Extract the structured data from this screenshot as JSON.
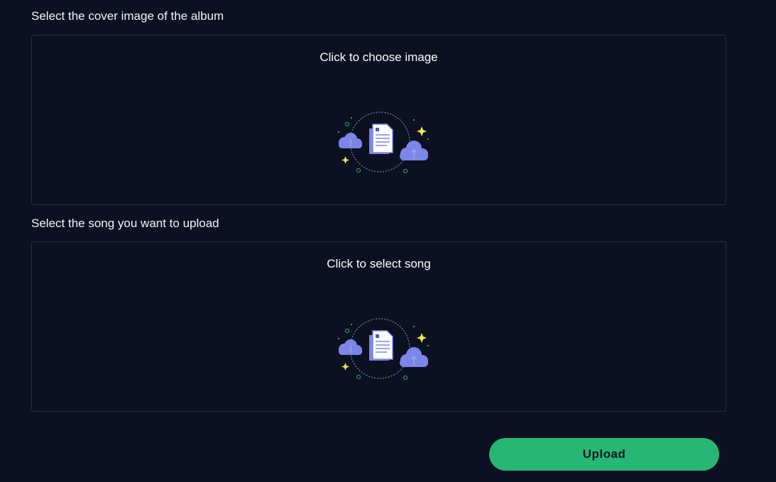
{
  "cover": {
    "label": "Select the cover image of the album",
    "dropzone_text": "Click to choose image",
    "icon": "cloud-upload-document-icon"
  },
  "song": {
    "label": "Select the song you want to upload",
    "dropzone_text": "Click to select song",
    "icon": "cloud-upload-document-icon"
  },
  "actions": {
    "upload_label": "Upload"
  },
  "colors": {
    "background": "#0b1120",
    "border": "#262d3d",
    "accent": "#27b673",
    "illustration": "#7b86e8",
    "sparkle": "#f2e64a",
    "dots": "#27b673"
  }
}
